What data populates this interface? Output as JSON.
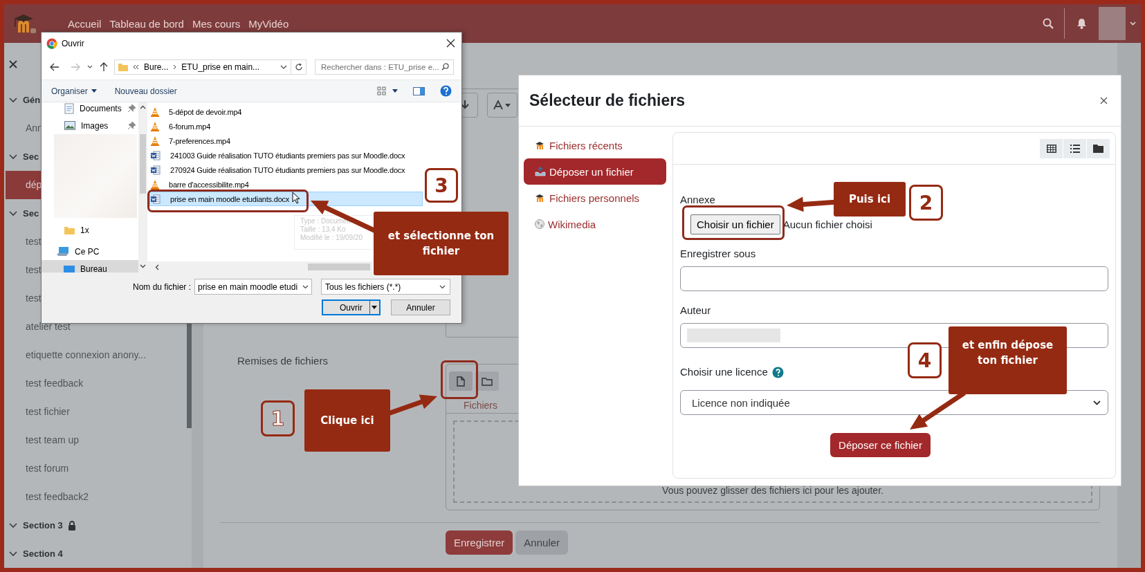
{
  "topbar": {
    "nav": [
      {
        "label": "Accueil"
      },
      {
        "label": "Tableau de bord"
      },
      {
        "label": "Mes cours"
      },
      {
        "label": "MyVidéo"
      }
    ]
  },
  "sidebar": {
    "items": [
      {
        "label": "Gén",
        "kind": "section",
        "selected": false,
        "locked": false
      },
      {
        "label": "Ann",
        "kind": "activity",
        "selected": false,
        "locked": false
      },
      {
        "label": "Sec",
        "kind": "section",
        "selected": false,
        "locked": false
      },
      {
        "label": "dép",
        "kind": "activity",
        "selected": true,
        "locked": false
      },
      {
        "label": "Sec",
        "kind": "section",
        "selected": false,
        "locked": false
      },
      {
        "label": "test",
        "kind": "activity",
        "selected": false,
        "locked": false
      },
      {
        "label": "test",
        "kind": "activity",
        "selected": false,
        "locked": false
      },
      {
        "label": "test",
        "kind": "activity",
        "selected": false,
        "locked": false
      },
      {
        "label": "atelier test",
        "kind": "activity",
        "selected": false,
        "locked": false
      },
      {
        "label": "etiquette connexion anony...",
        "kind": "activity",
        "selected": false,
        "locked": false
      },
      {
        "label": "test feedback",
        "kind": "activity",
        "selected": false,
        "locked": false
      },
      {
        "label": "test fichier",
        "kind": "activity",
        "selected": false,
        "locked": false
      },
      {
        "label": "test team up",
        "kind": "activity",
        "selected": false,
        "locked": false
      },
      {
        "label": "test forum",
        "kind": "activity",
        "selected": false,
        "locked": false
      },
      {
        "label": "test feedback2",
        "kind": "activity",
        "selected": false,
        "locked": false
      },
      {
        "label": "Section 3",
        "kind": "section",
        "selected": false,
        "locked": true
      },
      {
        "label": "Section 4",
        "kind": "section",
        "selected": false,
        "locked": false
      }
    ]
  },
  "form": {
    "field_label": "Remises de fichiers",
    "files_tab": "Fichiers",
    "drop_hint": "Vous pouvez glisser des fichiers ici pour les ajouter.",
    "buttons": [
      {
        "label": "Enregistrer",
        "kind": "primary"
      },
      {
        "label": "Annuler",
        "kind": "secondary"
      }
    ]
  },
  "open_dialog": {
    "title": "Ouvrir",
    "path": [
      "Bure...",
      "ETU_prise en main..."
    ],
    "search_placeholder": "Rechercher dans : ETU_prise e...",
    "toolbar": [
      "Organiser",
      "Nouveau dossier"
    ],
    "nav": [
      {
        "label": "Documents",
        "kind": "documents",
        "pinned": true,
        "selected": false
      },
      {
        "label": "Images",
        "kind": "images",
        "pinned": true,
        "selected": false
      },
      {
        "label": "1x",
        "kind": "folder",
        "pinned": false,
        "selected": false
      },
      {
        "label": "Ce PC",
        "kind": "pc",
        "pinned": false,
        "selected": false,
        "children": [
          {
            "label": "Bureau",
            "kind": "desktop",
            "pinned": false,
            "selected": true
          }
        ]
      }
    ],
    "files": [
      {
        "name": "5-dépot de devoir.mp4",
        "kind": "video",
        "selected": false
      },
      {
        "name": "6-forum.mp4",
        "kind": "video",
        "selected": false
      },
      {
        "name": "7-preferences.mp4",
        "kind": "video",
        "selected": false
      },
      {
        "name": "241003 Guide réalisation TUTO étudiants premiers pas sur Moodle.docx",
        "kind": "document",
        "selected": false
      },
      {
        "name": "270924 Guide réalisation TUTO étudiants premiers pas sur Moodle.docx",
        "kind": "document",
        "selected": false
      },
      {
        "name": "barre d'accessibilite.mp4",
        "kind": "video",
        "selected": false
      },
      {
        "name": "prise en main moodle etudiants.docx",
        "kind": "document",
        "selected": true
      }
    ],
    "tooltip": [
      "Type : Documen",
      "Taille : 13,4 Ko",
      "Modifié le : 19/09/20"
    ],
    "filename_label": "Nom du fichier :",
    "filename": "prise en main moodle etudi",
    "filter": "Tous les fichiers (*.*)",
    "buttons": [
      {
        "label": "Ouvrir",
        "kind": "split"
      },
      {
        "label": "Annuler",
        "kind": "plain"
      }
    ]
  },
  "file_picker": {
    "title": "Sélecteur de fichiers",
    "repositories": [
      {
        "label": "Fichiers récents",
        "kind": "moodle",
        "selected": false
      },
      {
        "label": "Déposer un fichier",
        "kind": "upload",
        "selected": true
      },
      {
        "label": "Fichiers personnels",
        "kind": "moodle",
        "selected": false
      },
      {
        "label": "Wikimedia",
        "kind": "wiki",
        "selected": false
      }
    ],
    "attachment_label": "Annexe",
    "choose_button": "Choisir un fichier",
    "no_file": "Aucun fichier choisi",
    "save_as_label": "Enregistrer sous",
    "author_label": "Auteur",
    "license_label": "Choisir une licence",
    "license": "Licence non indiquée",
    "submit": "Déposer ce fichier"
  },
  "annotations": [
    {
      "number": "1",
      "text": "Clique ici"
    },
    {
      "number": "2",
      "text": "Puis ici"
    },
    {
      "number": "3",
      "text": "et sélectionne ton fichier"
    },
    {
      "number": "4",
      "text": "et enfin dépose ton fichier"
    }
  ]
}
